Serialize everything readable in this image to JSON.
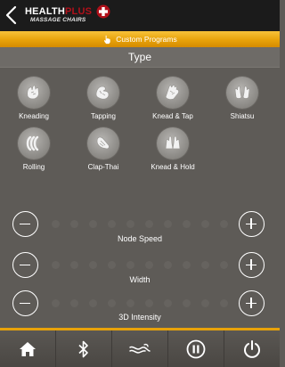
{
  "header": {
    "brand_main": "HEALTH",
    "brand_main_suffix": "PLUS",
    "brand_sub": "MASSAGE CHAIRS"
  },
  "programs_bar": {
    "label": "Custom Programs",
    "icon": "hand-pointer-icon"
  },
  "type_section": {
    "title": "Type",
    "items": [
      {
        "label": "Kneading",
        "icon": "kneading-hands-icon"
      },
      {
        "label": "Tapping",
        "icon": "tapping-hands-icon"
      },
      {
        "label": "Knead & Tap",
        "icon": "knead-tap-hands-icon"
      },
      {
        "label": "Shiatsu",
        "icon": "shiatsu-hands-icon"
      },
      {
        "label": "Rolling",
        "icon": "rolling-icon"
      },
      {
        "label": "Clap-Thai",
        "icon": "clap-thai-hands-icon"
      },
      {
        "label": "Knead & Hold",
        "icon": "knead-hold-hands-icon"
      }
    ]
  },
  "sliders": [
    {
      "label": "Node Speed",
      "level": 0,
      "steps": 10
    },
    {
      "label": "Width",
      "level": 0,
      "steps": 10
    },
    {
      "label": "3D Intensity",
      "level": 0,
      "steps": 10
    }
  ],
  "bottom_nav": [
    {
      "name": "home",
      "icon": "home-icon"
    },
    {
      "name": "bluetooth",
      "icon": "bluetooth-icon"
    },
    {
      "name": "feet",
      "icon": "feet-massage-icon"
    },
    {
      "name": "pause",
      "icon": "pause-icon"
    },
    {
      "name": "power",
      "icon": "power-icon"
    }
  ],
  "colors": {
    "accent": "#e8a20a",
    "background": "#5e5b57",
    "header": "#1b1b1b",
    "brand_red": "#b0101a"
  }
}
